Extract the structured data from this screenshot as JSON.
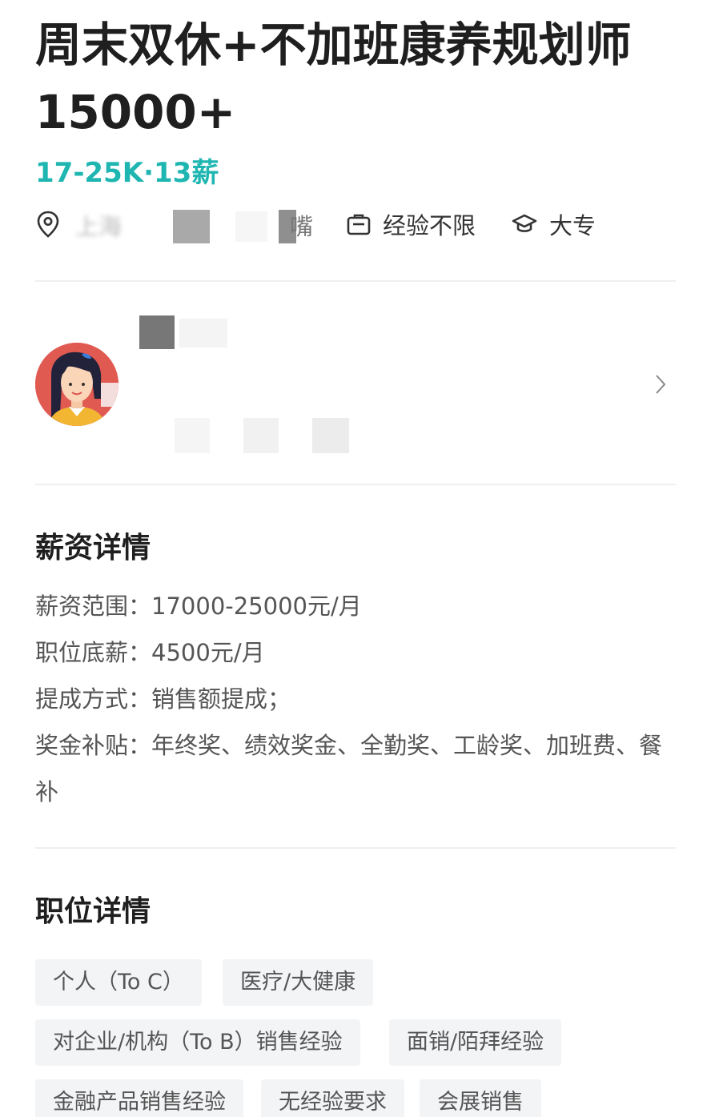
{
  "job": {
    "title": "周末双休+不加班康养规划师15000+",
    "salary": "17-25K·13薪",
    "location_partial": "上海",
    "location_tail": "嘴",
    "experience": "经验不限",
    "education": "大专"
  },
  "icons": {
    "location": "location-pin-icon",
    "experience": "briefcase-icon",
    "education": "graduation-cap-icon",
    "recruiter_chevron": "chevron-right-icon"
  },
  "salary_details": {
    "heading": "薪资详情",
    "rows": [
      {
        "label": "薪资范围：",
        "value": "17000-25000元/月"
      },
      {
        "label": "职位底薪：",
        "value": "4500元/月"
      },
      {
        "label": "提成方式：",
        "value": "销售额提成；"
      },
      {
        "label": "奖金补贴：",
        "value": "年终奖、绩效奖金、全勤奖、工龄奖、加班费、餐补"
      }
    ]
  },
  "position_details": {
    "heading": "职位详情",
    "tags": [
      "个人（To C）",
      "医疗/大健康",
      "对企业/机构（To B）销售经验",
      "面销/陌拜经验",
      "金融产品销售经验",
      "无经验要求",
      "会展销售"
    ]
  },
  "colors": {
    "accent": "#1fb6b1",
    "title": "#1f1f1f",
    "tag_bg": "#f3f4f6"
  }
}
